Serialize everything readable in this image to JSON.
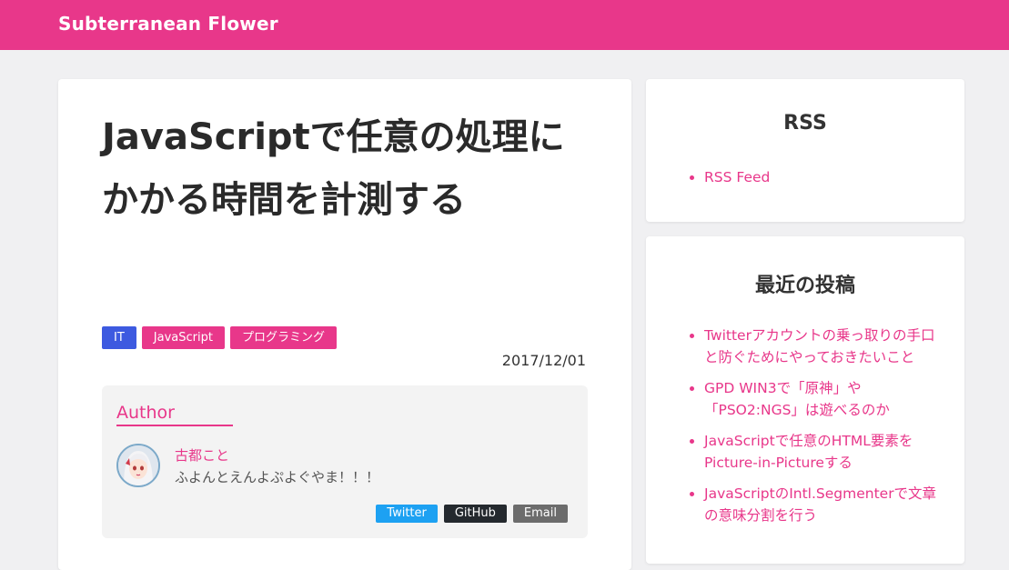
{
  "site": {
    "title": "Subterranean Flower"
  },
  "post": {
    "title": "JavaScriptで任意の処理にかかる時間を計測する",
    "date": "2017/12/01",
    "tags": [
      {
        "label": "IT",
        "color": "#3d5ae0"
      },
      {
        "label": "JavaScript",
        "color": "#e8378a"
      },
      {
        "label": "プログラミング",
        "color": "#e8378a"
      }
    ]
  },
  "author": {
    "heading": "Author",
    "name": "古都こと",
    "bio": "ふよんとえんよぷよぐやま！！！",
    "avatar_icon": "avatar-illustration",
    "links": [
      {
        "label": "Twitter",
        "color": "#1da1f2"
      },
      {
        "label": "GitHub",
        "color": "#24292e"
      },
      {
        "label": "Email",
        "color": "#6c6c6c"
      }
    ]
  },
  "sidebar": {
    "rss": {
      "heading": "RSS",
      "items": [
        "RSS Feed"
      ]
    },
    "recent": {
      "heading": "最近の投稿",
      "items": [
        "Twitterアカウントの乗っ取りの手口と防ぐためにやっておきたいこと",
        "GPD WIN3で「原神」や「PSO2:NGS」は遊べるのか",
        "JavaScriptで任意のHTML要素をPicture-in-Pictureする",
        "JavaScriptのIntl.Segmenterで文章の意味分割を行う"
      ]
    }
  },
  "colors": {
    "brand": "#e8378a",
    "background": "#f0f0f2"
  }
}
